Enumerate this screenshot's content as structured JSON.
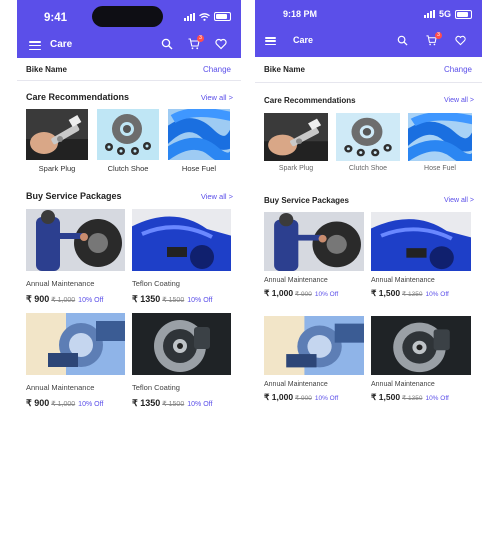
{
  "screens": [
    {
      "status": {
        "time": "9:41",
        "network": ""
      },
      "appbar": {
        "title": "Care",
        "cart_badge": "3"
      },
      "bike": {
        "label": "Bike Name",
        "change": "Change"
      },
      "recommendations": {
        "title": "Care Recommendations",
        "view_all": "View all >",
        "items": [
          {
            "label": "Spark Plug"
          },
          {
            "label": "Clutch Shoe"
          },
          {
            "label": "Hose Fuel"
          }
        ]
      },
      "packages": {
        "title": "Buy Service Packages",
        "view_all": "View all >",
        "items": [
          {
            "name": "Annual Maintenance",
            "price": "₹ 900",
            "mrp": "₹ 1,000",
            "off": "10% Off"
          },
          {
            "name": "Teflon Coating",
            "price": "₹ 1350",
            "mrp": "₹ 1500",
            "off": "10% Off"
          },
          {
            "name": "Annual Maintenance",
            "price": "₹ 900",
            "mrp": "₹ 1,000",
            "off": "10% Off"
          },
          {
            "name": "Teflon Coating",
            "price": "₹ 1350",
            "mrp": "₹ 1500",
            "off": "10% Off"
          }
        ]
      }
    },
    {
      "status": {
        "time": "9:18 PM",
        "network": "5G"
      },
      "appbar": {
        "title": "Care",
        "cart_badge": "3"
      },
      "bike": {
        "label": "Bike Name",
        "change": "Change"
      },
      "recommendations": {
        "title": "Care Recommendations",
        "view_all": "View all >",
        "items": [
          {
            "label": "Spark Plug"
          },
          {
            "label": "Clutch Shoe"
          },
          {
            "label": "Hose Fuel"
          }
        ]
      },
      "packages": {
        "title": "Buy Service Packages",
        "view_all": "View all >",
        "items": [
          {
            "name": "Annual Maintenance",
            "price": "₹ 1,000",
            "mrp": "₹ 900",
            "off": "10% Off"
          },
          {
            "name": "Annual Maintenance",
            "price": "₹ 1,500",
            "mrp": "₹ 1350",
            "off": "10% Off"
          },
          {
            "name": "Annual Maintenance",
            "price": "₹ 1,000",
            "mrp": "₹ 900",
            "off": "10% Off"
          },
          {
            "name": "Annual Maintenance",
            "price": "₹ 1,500",
            "mrp": "₹ 1350",
            "off": "10% Off"
          }
        ]
      }
    }
  ],
  "colors": {
    "brand": "#5B4FE9",
    "badge": "#ff4d4d"
  }
}
